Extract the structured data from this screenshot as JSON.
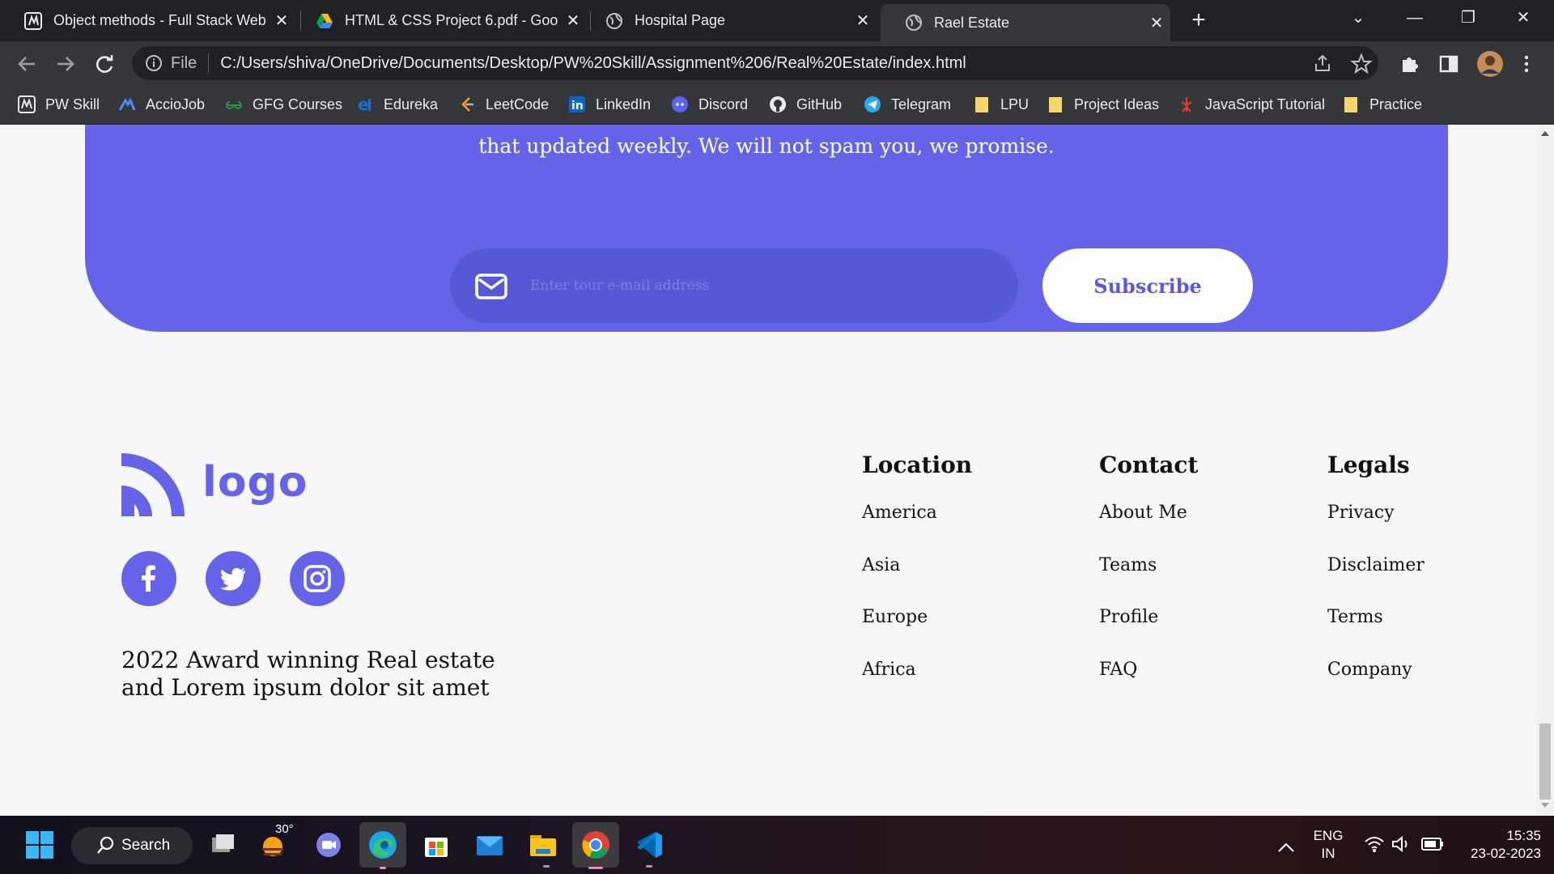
{
  "browser": {
    "tabs": [
      {
        "title": "Object methods - Full Stack Web",
        "active": false
      },
      {
        "title": "HTML & CSS Project 6.pdf - Goo",
        "active": false
      },
      {
        "title": "Hospital Page",
        "active": false
      },
      {
        "title": "Rael Estate",
        "active": true
      }
    ],
    "new_tab_label": "+",
    "address": {
      "scheme_label": "File",
      "url": "C:/Users/shiva/OneDrive/Documents/Desktop/PW%20Skill/Assignment%206/Real%20Estate/index.html"
    },
    "bookmarks": [
      "PW Skill",
      "AccioJob",
      "GFG Courses",
      "Edureka",
      "LeetCode",
      "LinkedIn",
      "Discord",
      "GitHub",
      "Telegram",
      "LPU",
      "Project Ideas",
      "JavaScript Tutorial",
      "Practice"
    ]
  },
  "page": {
    "newsletter": {
      "tagline": "that updated weekly. We will not spam you, we promise.",
      "email_placeholder": "Enter tour e-mail address",
      "subscribe_label": "Subscribe"
    },
    "footer": {
      "logo_text": "logo",
      "socials": [
        "facebook",
        "twitter",
        "instagram"
      ],
      "award_text": "2022 Award winning Real estate and Lorem ipsum dolor sit amet",
      "columns": [
        {
          "title": "Location",
          "links": [
            "America",
            "Asia",
            "Europe",
            "Africa"
          ]
        },
        {
          "title": "Contact",
          "links": [
            "About Me",
            "Teams",
            "Profile",
            "FAQ"
          ]
        },
        {
          "title": "Legals",
          "links": [
            "Privacy",
            "Disclaimer",
            "Terms",
            "Company"
          ]
        }
      ]
    }
  },
  "taskbar": {
    "search_label": "Search",
    "weather_temp": "30°",
    "language": "ENG",
    "region": "IN",
    "time": "15:35",
    "date": "23-02-2023"
  },
  "colors": {
    "accent": "#6564e9",
    "input_bg": "#5658d6",
    "chrome_dark": "#202124",
    "chrome_mid": "#35363a"
  }
}
